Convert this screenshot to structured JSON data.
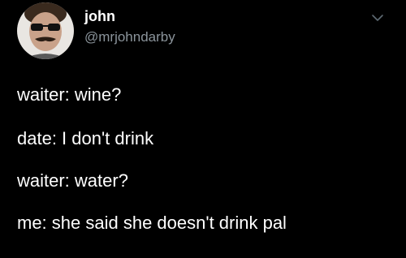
{
  "tweet": {
    "author": {
      "name": "john",
      "handle": "@mrjohndarby",
      "avatar_icon": "user-avatar"
    },
    "menu_icon": "chevron-down-icon",
    "lines": [
      "waiter: wine?",
      "date: I don't drink",
      "waiter: water?",
      "me: she said she doesn't drink pal"
    ]
  },
  "colors": {
    "background": "#000000",
    "text": "#ffffff",
    "secondary_text": "#8b949b"
  }
}
